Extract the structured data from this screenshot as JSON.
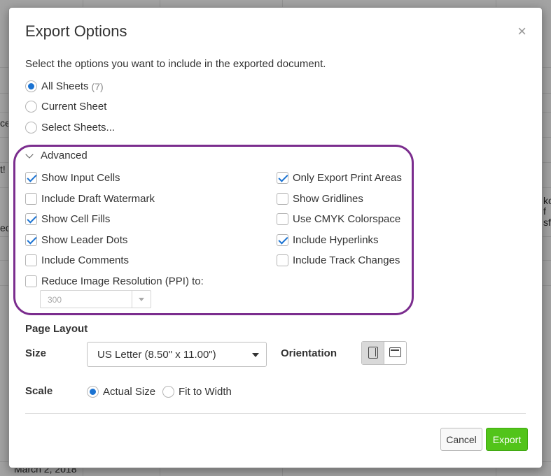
{
  "background": {
    "fragments": [
      "ce",
      "t!",
      "ec",
      "ko",
      "f",
      "sf",
      "March 2, 2018"
    ]
  },
  "dialog": {
    "title": "Export Options",
    "close_glyph": "×",
    "intro": "Select the options you want to include in the exported document.",
    "sheets": {
      "all_label": "All Sheets",
      "all_count": "(7)",
      "current_label": "Current Sheet",
      "select_label": "Select Sheets...",
      "selected": "All Sheets"
    },
    "advanced": {
      "header": "Advanced",
      "left": [
        {
          "label": "Show Input Cells",
          "checked": true
        },
        {
          "label": "Include Draft Watermark",
          "checked": false
        },
        {
          "label": "Show Cell Fills",
          "checked": true
        },
        {
          "label": "Show Leader Dots",
          "checked": true
        },
        {
          "label": "Include Comments",
          "checked": false
        },
        {
          "label": "Reduce Image Resolution (PPI) to:",
          "checked": false
        }
      ],
      "right": [
        {
          "label": "Only Export Print Areas",
          "checked": true
        },
        {
          "label": "Show Gridlines",
          "checked": false
        },
        {
          "label": "Use CMYK Colorspace",
          "checked": false
        },
        {
          "label": "Include Hyperlinks",
          "checked": true
        },
        {
          "label": "Include Track Changes",
          "checked": false
        }
      ],
      "ppi_value": "300",
      "highlight_color": "#7b2d8e"
    },
    "page_layout": {
      "heading": "Page Layout",
      "size_label": "Size",
      "size_value": "US Letter (8.50\" x 11.00\")",
      "orientation_label": "Orientation",
      "orientation_selected": "portrait",
      "scale_label": "Scale",
      "scale_actual": "Actual Size",
      "scale_fit": "Fit to Width",
      "scale_selected": "Actual Size"
    },
    "buttons": {
      "cancel": "Cancel",
      "export": "Export",
      "export_color": "#52c41a"
    },
    "accent_color": "#1b73d2"
  }
}
